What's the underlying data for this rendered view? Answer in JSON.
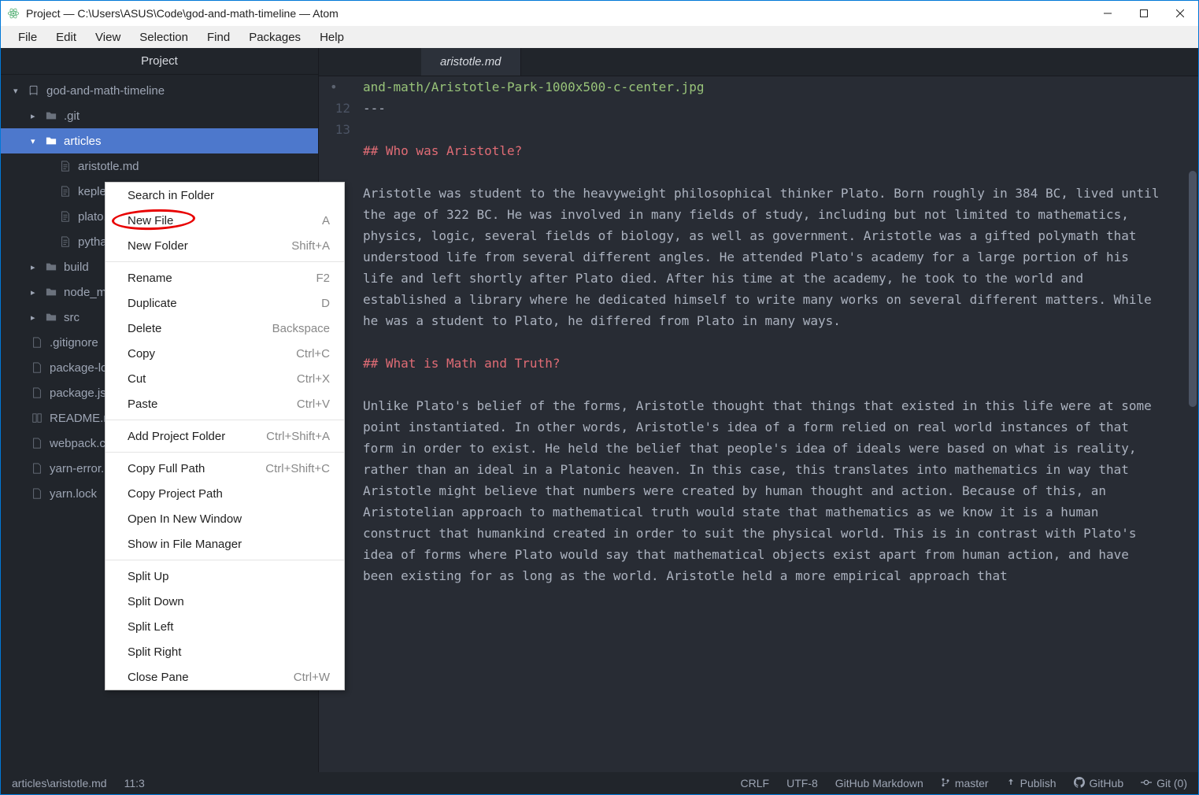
{
  "window": {
    "title": "Project — C:\\Users\\ASUS\\Code\\god-and-math-timeline — Atom"
  },
  "menubar": [
    "File",
    "Edit",
    "View",
    "Selection",
    "Find",
    "Packages",
    "Help"
  ],
  "sidebar": {
    "title": "Project",
    "tree": {
      "root": "god-and-math-timeline",
      "git": ".git",
      "articles": "articles",
      "files": [
        "aristotle.md",
        "kepler.md",
        "plato.md",
        "pythagoras.md"
      ],
      "build": "build",
      "node": "node_modules",
      "src": "src",
      "extras": [
        ".gitignore",
        "package-lock.json",
        "package.json",
        "README.md",
        "webpack.config.js",
        "yarn-error.log",
        "yarn.lock"
      ]
    }
  },
  "tab": {
    "name": "aristotle.md"
  },
  "editor": {
    "line11": "and-math/Aristotle-Park-1000x500-c-center.jpg",
    "line12_num": "12",
    "line12": "---",
    "line13_num": "13",
    "line14blank": "",
    "h1": "## Who was Aristotle?",
    "p1": "Aristotle was student to the heavyweight philosophical thinker Plato. Born roughly in 384 BC, lived until the age of 322 BC. He was involved in many fields of study, including but not limited to mathematics, physics, logic, several fields of biology, as well as government. Aristotle was a gifted polymath that understood life from several different angles. He attended Plato's academy for a large portion of his life and left shortly after Plato died. After his time at the academy, he took to the world and established a library where he dedicated himself to write many works on several different matters. While he was a student to Plato, he differed from Plato in many ways.",
    "h2": "## What is Math and Truth?",
    "p2": "Unlike Plato's belief of the forms, Aristotle thought that things that existed in this life were at some point instantiated. In other words, Aristotle's idea of a form relied on real world instances of that form in order to exist. He held the belief that people's idea of ideals were based on what is reality, rather than an ideal in a Platonic heaven. In this case, this translates into mathematics in way that Aristotle might believe that numbers were created by human thought and action. Because of this, an Aristotelian approach to mathematical truth would state that mathematics as we know it is a human construct that humankind created in order to suit the physical world. This is in contrast with Plato's idea of forms where Plato would say that mathematical objects exist apart from human action, and have been existing for as long as the world. Aristotle held a more empirical approach that"
  },
  "context_menu": {
    "items": [
      {
        "label": "Search in Folder",
        "shortcut": ""
      },
      {
        "label": "New File",
        "shortcut": "A"
      },
      {
        "label": "New Folder",
        "shortcut": "Shift+A"
      },
      {
        "sep": true
      },
      {
        "label": "Rename",
        "shortcut": "F2"
      },
      {
        "label": "Duplicate",
        "shortcut": "D"
      },
      {
        "label": "Delete",
        "shortcut": "Backspace"
      },
      {
        "label": "Copy",
        "shortcut": "Ctrl+C"
      },
      {
        "label": "Cut",
        "shortcut": "Ctrl+X"
      },
      {
        "label": "Paste",
        "shortcut": "Ctrl+V"
      },
      {
        "sep": true
      },
      {
        "label": "Add Project Folder",
        "shortcut": "Ctrl+Shift+A"
      },
      {
        "sep": true
      },
      {
        "label": "Copy Full Path",
        "shortcut": "Ctrl+Shift+C"
      },
      {
        "label": "Copy Project Path",
        "shortcut": ""
      },
      {
        "label": "Open In New Window",
        "shortcut": ""
      },
      {
        "label": "Show in File Manager",
        "shortcut": ""
      },
      {
        "sep": true
      },
      {
        "label": "Split Up",
        "shortcut": ""
      },
      {
        "label": "Split Down",
        "shortcut": ""
      },
      {
        "label": "Split Left",
        "shortcut": ""
      },
      {
        "label": "Split Right",
        "shortcut": ""
      },
      {
        "label": "Close Pane",
        "shortcut": "Ctrl+W"
      }
    ]
  },
  "statusbar": {
    "path": "articles\\aristotle.md",
    "cursor": "11:3",
    "eol": "CRLF",
    "encoding": "UTF-8",
    "grammar": "GitHub Markdown",
    "branch": "master",
    "publish": "Publish",
    "github": "GitHub",
    "git": "Git (0)"
  }
}
